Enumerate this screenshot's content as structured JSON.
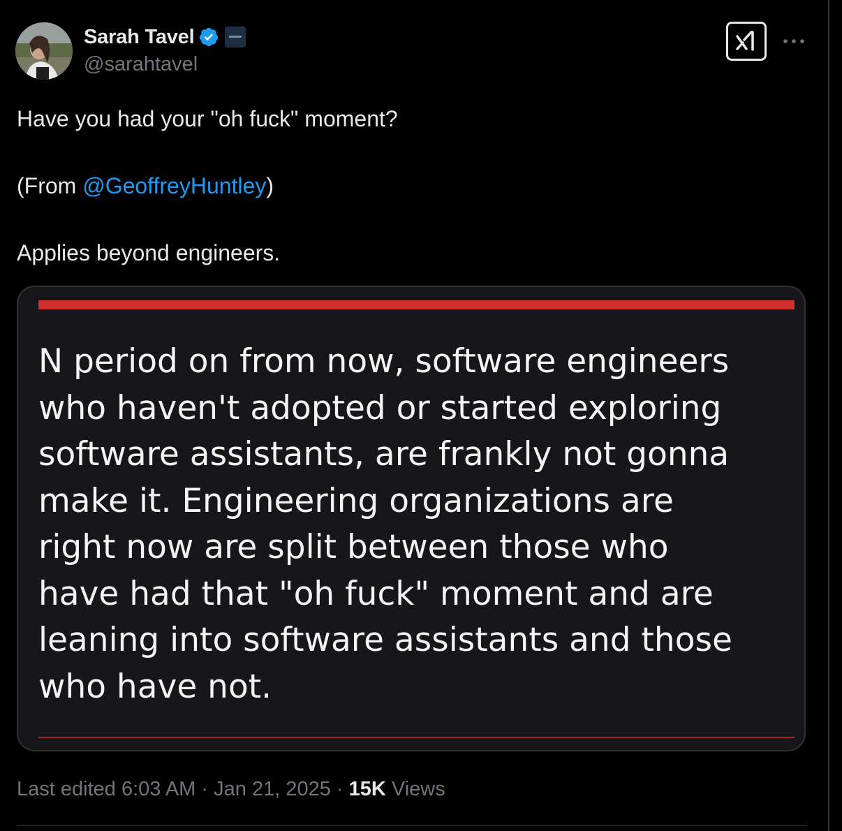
{
  "author": {
    "display_name": "Sarah Tavel",
    "handle": "@sarahtavel",
    "verified_color": "#1d9bf0",
    "avatar_icon": "profile-photo"
  },
  "actions": {
    "grok_icon": "grok-icon",
    "more_icon": "more-icon"
  },
  "tweet": {
    "line1": "Have you had your \"oh fuck\" moment?",
    "line2_prefix": "(From ",
    "line2_mention": "@GeoffreyHuntley",
    "line2_suffix": ")",
    "line3": "Applies beyond engineers."
  },
  "media": {
    "accent_color": "#d0302b",
    "lines": [
      "N period on from now, software engineers",
      "who haven't adopted or started exploring",
      "software assistants, are frankly not gonna",
      "make it. Engineering organizations are",
      "right now are split between those who",
      "have had that \"oh fuck\" moment and are",
      "leaning into software assistants and those",
      "who have not."
    ]
  },
  "meta": {
    "edited_label": "Last edited 6:03 AM",
    "separator": " · ",
    "date": "Jan 21, 2025",
    "views_count": "15K",
    "views_label": "Views"
  }
}
